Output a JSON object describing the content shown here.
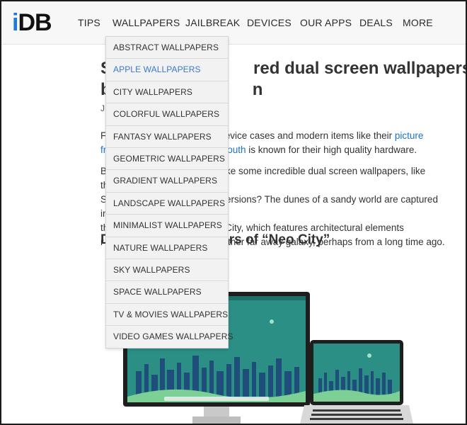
{
  "logo": {
    "prefix": "i",
    "rest": "DB"
  },
  "nav": [
    {
      "label": "TIPS"
    },
    {
      "label": "WALLPAPERS"
    },
    {
      "label": "JAILBREAK"
    },
    {
      "label": "DEVICES"
    },
    {
      "label": "OUR APPS"
    },
    {
      "label": "DEALS"
    },
    {
      "label": "MORE"
    }
  ],
  "dropdown": [
    {
      "label": "ABSTRACT WALLPAPERS"
    },
    {
      "label": "APPLE WALLPAPERS",
      "active": true
    },
    {
      "label": "CITY WALLPAPERS"
    },
    {
      "label": "COLORFUL WALLPAPERS"
    },
    {
      "label": "FANTASY WALLPAPERS"
    },
    {
      "label": "GEOMETRIC WALLPAPERS"
    },
    {
      "label": "GRADIENT WALLPAPERS"
    },
    {
      "label": "LANDSCAPE WALLPAPERS"
    },
    {
      "label": "MINIMALIST WALLPAPERS"
    },
    {
      "label": "NATURE WALLPAPERS"
    },
    {
      "label": "SKY WALLPAPERS"
    },
    {
      "label": "SPACE WALLPAPERS"
    },
    {
      "label": "TV & MOVIES WALLPAPERS"
    },
    {
      "label": "VIDEO GAMES WALLPAPERS"
    }
  ],
  "article": {
    "title_line1": "S                              red dual screen wallpapers",
    "title_line2": "b                              n",
    "byline": "J",
    "p1_a": "F",
    "p1_b": "device cases and modern items like their",
    "p1_link1": "picture",
    "p1_c": "fr",
    "p1_link2": "South",
    "p1_d": "is known for their high quality hardware.",
    "p2_l1a": "B",
    "p2_l1b": "ke some incredible dual screen wallpapers, like these",
    "p2_l2a": "S",
    "p2_l2b": "ersions? The dunes of a sandy world are captured in",
    "p2_l3a": "th",
    "p2_l3b": "City, which features architectural elements",
    "p2_l4a": "r",
    "p2_l4b": "other far away galaxy, perhaps from a long time ago.",
    "heading_a": "D",
    "heading_b": "rs of “Neo City”"
  },
  "colors": {
    "accent": "#1f7ae0",
    "link": "#1a73c9",
    "active_menu": "#3a78d4",
    "menu_bg": "#f2f2f2",
    "sky": "#2a8f86",
    "ground": "#7ccf95"
  }
}
